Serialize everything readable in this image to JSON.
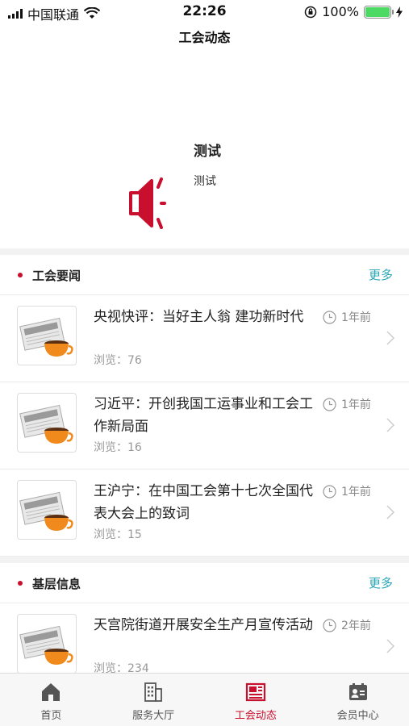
{
  "status_bar": {
    "carrier": "中国联通",
    "time": "22:26",
    "battery": "100%",
    "icons": [
      "signal-icon",
      "wifi-icon",
      "orientation-lock-icon",
      "battery-icon",
      "charging-icon"
    ]
  },
  "nav": {
    "title": "工会动态"
  },
  "notice": {
    "icon": "speaker-icon",
    "title": "测试",
    "subtitle": "测试"
  },
  "sections": [
    {
      "title": "工会要闻",
      "more": "更多",
      "items": [
        {
          "title": "央视快评：当好主人翁 建功新时代",
          "views": "浏览：76",
          "time": "1年前"
        },
        {
          "title": "习近平：开创我国工运事业和工会工作新局面",
          "views": "浏览：16",
          "time": "1年前"
        },
        {
          "title": "王沪宁：在中国工会第十七次全国代表大会上的致词",
          "views": "浏览：15",
          "time": "1年前"
        }
      ]
    },
    {
      "title": "基层信息",
      "more": "更多",
      "items": [
        {
          "title": "天宫院街道开展安全生产月宣传活动",
          "views": "浏览：234",
          "time": "2年前"
        }
      ]
    }
  ],
  "tabs": [
    {
      "label": "首页",
      "icon": "home-icon",
      "active": false
    },
    {
      "label": "服务大厅",
      "icon": "building-icon",
      "active": false
    },
    {
      "label": "工会动态",
      "icon": "newspaper-icon",
      "active": true
    },
    {
      "label": "会员中心",
      "icon": "member-card-icon",
      "active": false
    }
  ],
  "colors": {
    "accent": "#c8102e",
    "link": "#2aa5b8",
    "battery": "#4cd964"
  }
}
